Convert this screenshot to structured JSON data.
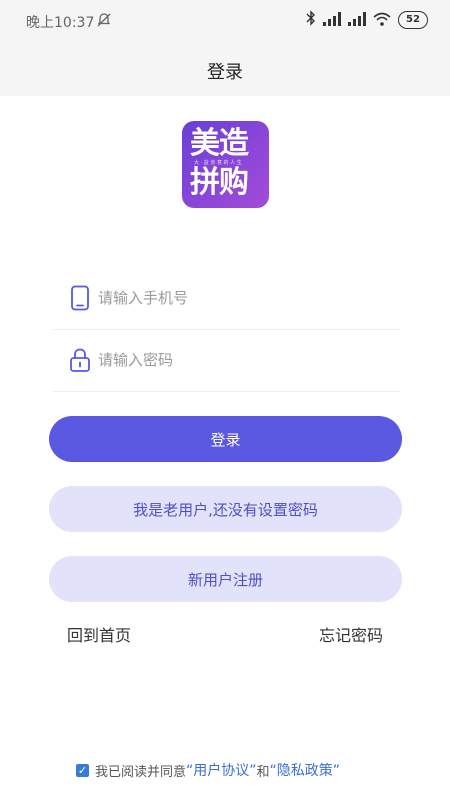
{
  "status_bar": {
    "time": "晚上10:37",
    "battery": "52"
  },
  "header": {
    "title": "登录"
  },
  "logo": {
    "line1": "美造",
    "slogan": "大 · 益 创 意 的 人 生",
    "line2": "拼购"
  },
  "form": {
    "phone_placeholder": "请输入手机号",
    "password_placeholder": "请输入密码"
  },
  "buttons": {
    "login": "登录",
    "old_user": "我是老用户,还没有设置密码",
    "register": "新用户注册"
  },
  "links": {
    "home": "回到首页",
    "forgot_password": "忘记密码"
  },
  "agreement": {
    "checked": true,
    "prefix": "我已阅读并同意",
    "user_agreement": "“用户协议”",
    "and": "和",
    "privacy_policy": "“隐私政策”"
  },
  "colors": {
    "primary": "#5a58e0",
    "secondary_bg": "#e3e2fb",
    "secondary_text": "#4e4fc9",
    "link": "#3a6fd4"
  }
}
